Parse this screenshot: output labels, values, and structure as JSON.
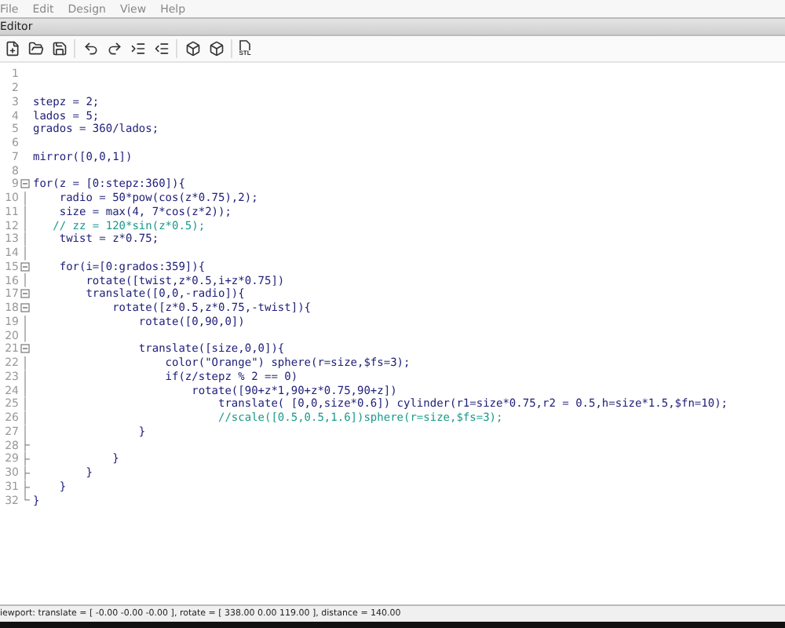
{
  "menu": [
    "File",
    "Edit",
    "Design",
    "View",
    "Help"
  ],
  "panel": {
    "title": "Editor"
  },
  "toolbar": [
    {
      "kind": "new"
    },
    {
      "kind": "open"
    },
    {
      "kind": "save"
    },
    {
      "kind": "sep"
    },
    {
      "kind": "undo"
    },
    {
      "kind": "redo"
    },
    {
      "kind": "indent"
    },
    {
      "kind": "unindent"
    },
    {
      "kind": "sep"
    },
    {
      "kind": "preview"
    },
    {
      "kind": "render"
    },
    {
      "kind": "sep"
    },
    {
      "kind": "export",
      "label": "STL"
    }
  ],
  "lines": [
    {
      "n": "1",
      "kind": "plain"
    },
    {
      "n": "2",
      "kind": "plain"
    },
    {
      "n": "3",
      "text": "stepz = 2;",
      "kind": "plain"
    },
    {
      "n": "4",
      "text": "lados = 5;",
      "kind": "plain"
    },
    {
      "n": "5",
      "text": "grados = 360/lados;",
      "kind": "plain"
    },
    {
      "n": "6",
      "kind": "plain"
    },
    {
      "n": "7",
      "text": "mirror([0,0,1])",
      "kind": "plain"
    },
    {
      "n": "8",
      "kind": "plain"
    },
    {
      "n": "9",
      "text": "for(z = [0:stepz:360]){",
      "kind": "open"
    },
    {
      "n": "10",
      "text": "    radio = 50*pow(cos(z*0.75),2);",
      "kind": "line"
    },
    {
      "n": "11",
      "text": "    size = max(4, 7*cos(z*2));",
      "kind": "line"
    },
    {
      "n": "12",
      "text": "   // zz = 120*sin(z*0.5);",
      "kind": "line",
      "comment": true
    },
    {
      "n": "13",
      "text": "    twist = z*0.75;",
      "kind": "line"
    },
    {
      "n": "14",
      "kind": "line"
    },
    {
      "n": "15",
      "text": "    for(i=[0:grados:359]){",
      "kind": "open"
    },
    {
      "n": "16",
      "text": "        rotate([twist,z*0.5,i+z*0.75])",
      "kind": "line"
    },
    {
      "n": "17",
      "text": "        translate([0,0,-radio]){",
      "kind": "open"
    },
    {
      "n": "18",
      "text": "            rotate([z*0.5,z*0.75,-twist]){",
      "kind": "open"
    },
    {
      "n": "19",
      "text": "                rotate([0,90,0])",
      "kind": "line"
    },
    {
      "n": "20",
      "kind": "line"
    },
    {
      "n": "21",
      "text": "                translate([size,0,0]){",
      "kind": "open"
    },
    {
      "n": "22",
      "text": "                    color(\"Orange\") sphere(r=size,$fs=3);",
      "kind": "line"
    },
    {
      "n": "23",
      "text": "                    if(z/stepz % 2 == 0)",
      "kind": "line"
    },
    {
      "n": "24",
      "text": "                        rotate([90+z*1,90+z*0.75,90+z])",
      "kind": "line"
    },
    {
      "n": "25",
      "text": "                            translate( [0,0,size*0.6]) cylinder(r1=size*0.75,r2 = 0.5,h=size*1.5,$fn=10);",
      "kind": "line"
    },
    {
      "n": "26",
      "text": "                            //scale([0.5,0.5,1.6])sphere(r=size,$fs=3);",
      "kind": "line",
      "comment": true
    },
    {
      "n": "27",
      "text": "                }",
      "kind": "line"
    },
    {
      "n": "28",
      "kind": "end"
    },
    {
      "n": "29",
      "text": "            }",
      "kind": "end"
    },
    {
      "n": "30",
      "text": "        }",
      "kind": "end"
    },
    {
      "n": "31",
      "text": "    }",
      "kind": "end"
    },
    {
      "n": "32",
      "text": "}",
      "kind": "last"
    }
  ],
  "status_bar": "iewport: translate = [ -0.00 -0.00 -0.00 ], rotate = [ 338.00 0.00 119.00 ], distance = 140.00"
}
